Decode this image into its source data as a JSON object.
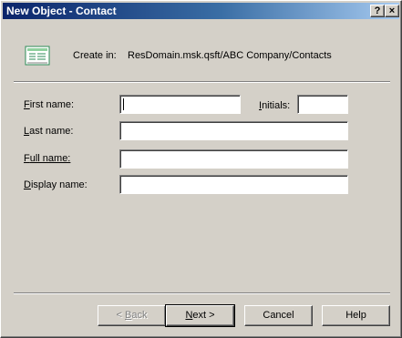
{
  "window": {
    "title": "New Object - Contact",
    "help_glyph": "?",
    "close_glyph": "×"
  },
  "header": {
    "icon": "contact-card-icon",
    "create_in_label": "Create in:",
    "create_in_path": "ResDomain.msk.qsft/ABC Company/Contacts"
  },
  "form": {
    "first_name": {
      "accel": "F",
      "rest": "irst name:",
      "value": ""
    },
    "initials": {
      "accel": "I",
      "rest": "nitials:",
      "value": ""
    },
    "last_name": {
      "accel": "L",
      "rest": "ast name:",
      "value": ""
    },
    "full_name": {
      "accel": "F",
      "rest": "ull name:",
      "value": ""
    },
    "display_name": {
      "accel": "D",
      "rest": "isplay name:",
      "value": ""
    }
  },
  "buttons": {
    "back": {
      "pre": "< ",
      "accel": "B",
      "rest": "ack"
    },
    "next": {
      "accel": "N",
      "rest": "ext >"
    },
    "cancel": "Cancel",
    "help": "Help"
  },
  "colors": {
    "title_start": "#0a246a",
    "title_end": "#a6caf0",
    "face": "#d4d0c8",
    "icon_green": "#2e8b57"
  }
}
